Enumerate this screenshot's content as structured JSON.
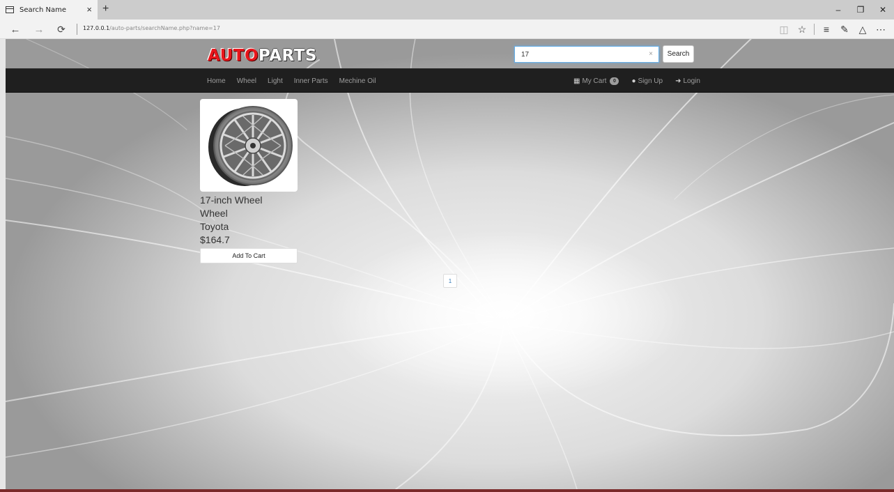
{
  "browser": {
    "tab_title": "Search Name",
    "tab_close": "×",
    "new_tab": "+",
    "url_host": "127.0.0.1",
    "url_path": "/auto-parts/searchName.php?name=17",
    "icons": [
      "back-icon",
      "forward-icon",
      "refresh-icon",
      "reading-view-icon",
      "favorite-star-icon",
      "hub-icon",
      "web-note-icon",
      "share-icon",
      "more-icon"
    ]
  },
  "site": {
    "logo_auto": "AUTO",
    "logo_parts": "PARTS",
    "search": {
      "value": "17",
      "clear": "×",
      "button": "Search"
    },
    "nav": [
      {
        "label": "Home"
      },
      {
        "label": "Wheel"
      },
      {
        "label": "Light"
      },
      {
        "label": "Inner Parts"
      },
      {
        "label": "Mechine Oil"
      }
    ],
    "nav_right": {
      "cart_label": "My Cart",
      "cart_count": "0",
      "signup": "Sign Up",
      "login": "Login"
    }
  },
  "product": {
    "name": "17-inch Wheel",
    "category": "Wheel",
    "brand": "Toyota",
    "price": "$164.7",
    "button": "Add To Cart"
  },
  "pagination": {
    "current": "1"
  },
  "colors": {
    "navbar": "#1f1f1f",
    "logo_red": "#e8161c",
    "focus_blue": "#66afe9"
  }
}
